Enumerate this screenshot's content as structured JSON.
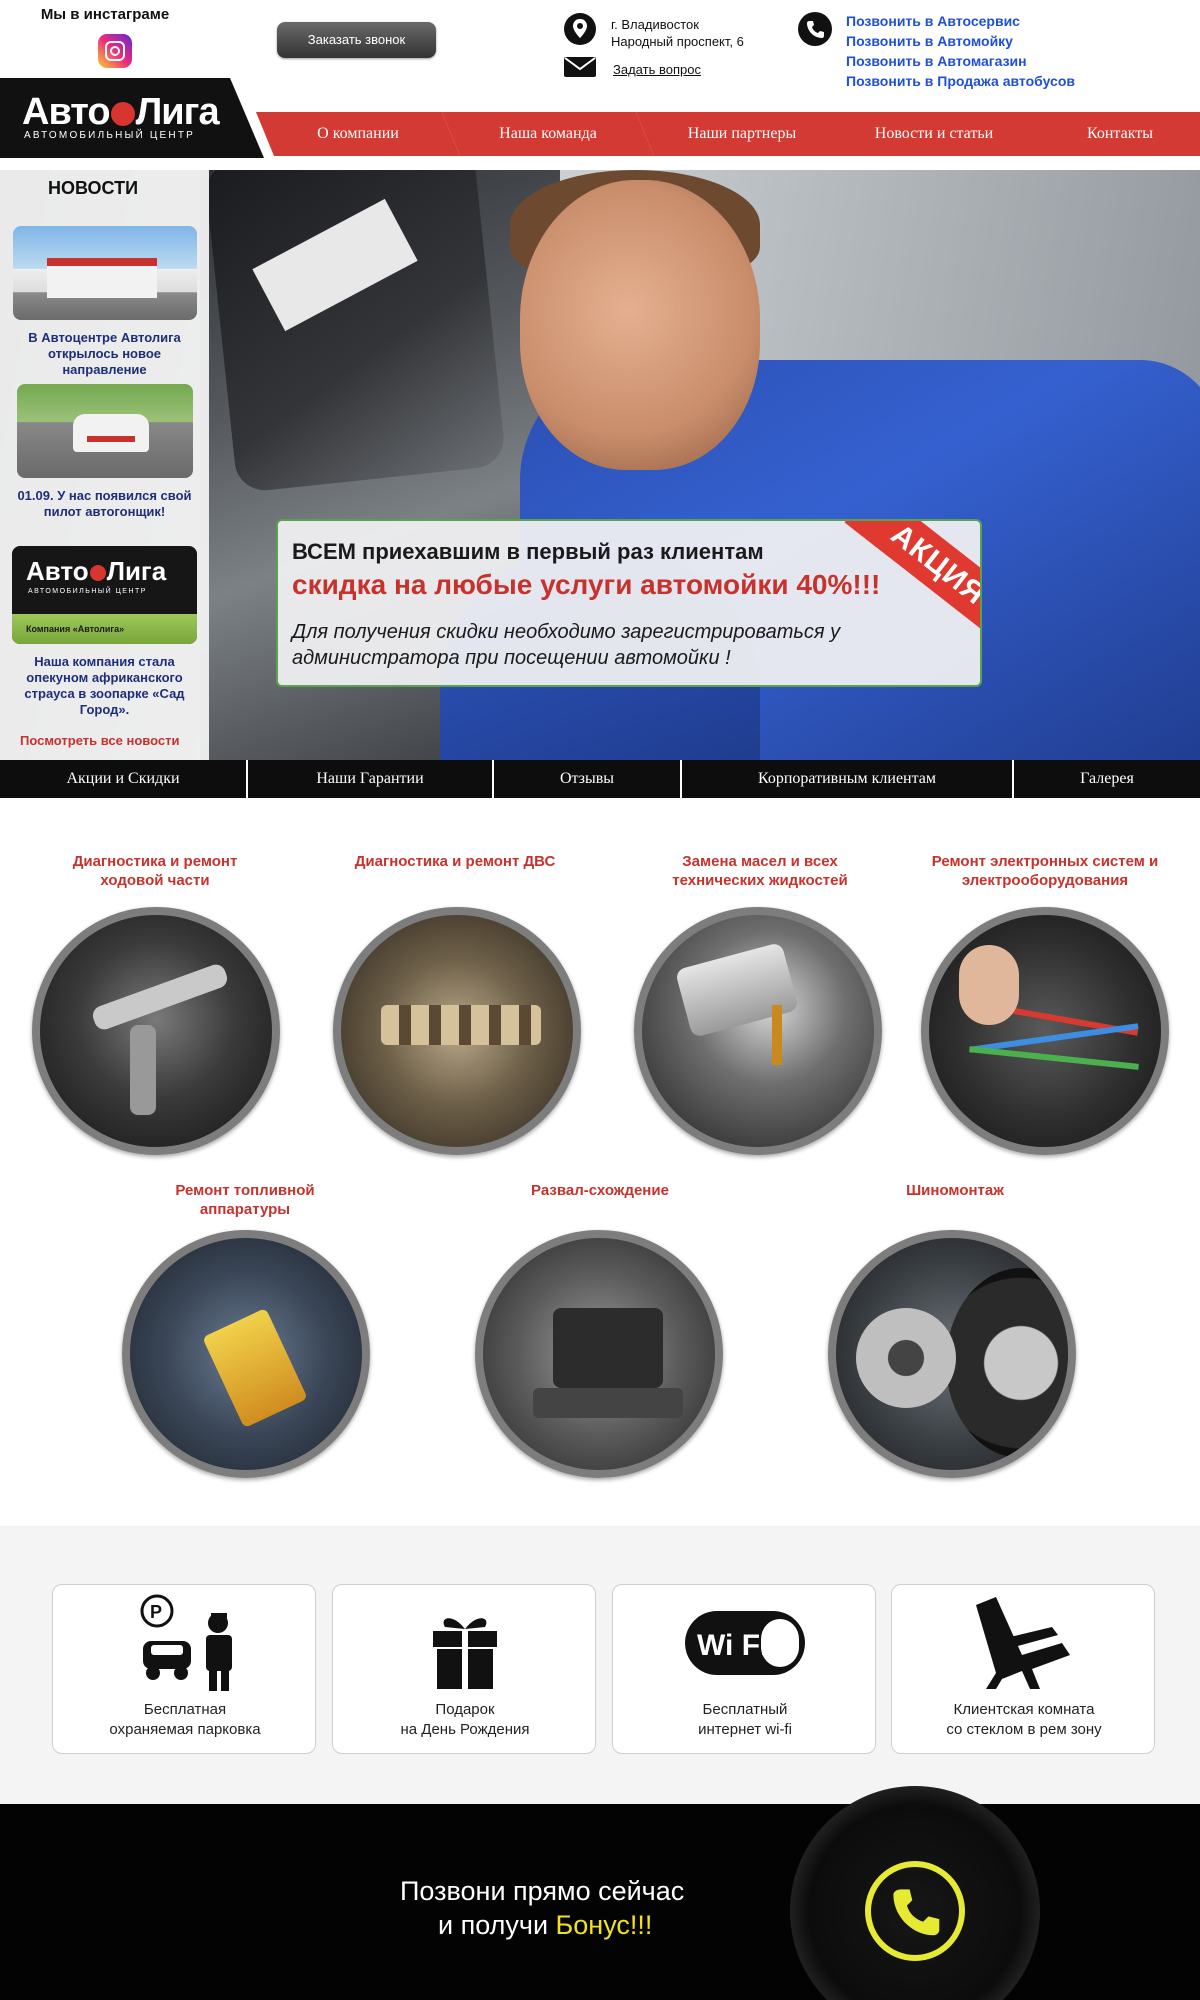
{
  "header": {
    "instagram_title": "Мы в инстаграме",
    "call_button": "Заказать звонок",
    "address_line1": "г. Владивосток",
    "address_line2": "Народный проспект, 6",
    "ask_question": "Задать вопрос",
    "call_links": [
      "Позвонить в Автосервис",
      "Позвонить в Автомойку",
      "Позвонить в Автомагазин",
      "Позвонить в Продажа автобусов"
    ],
    "link_color": "#1f4fd6"
  },
  "logo": {
    "name_part1": "Авто",
    "name_part2": "Лига",
    "subtitle": "АВТОМОБИЛЬНЫЙ ЦЕНТР"
  },
  "nav": {
    "items": [
      "О компании",
      "Наша команда",
      "Наши партнеры",
      "Новости и статьи",
      "Контакты"
    ],
    "accent": "#d23a33"
  },
  "news": {
    "title": "НОВОСТИ",
    "items": [
      "В Автоцентре Автолига открылось новое направление",
      "01.09. У нас появился свой пилот автогонщик!",
      "Наша компания стала опекуном африканского страуса в зоопарке «Сад Город»."
    ],
    "logo_card_caption": "Компания «Автолига»",
    "all_news": "Посмотреть все новости"
  },
  "promo": {
    "line1": "ВСЕМ приехавшим в первый раз клиентам",
    "line2": "скидка на любые  услуги автомойки 40%!!!",
    "line3": "Для получения скидки необходимо зарегистрироваться у администратора при посещении автомойки !",
    "ribbon": "АКЦИЯ"
  },
  "subnav": {
    "items": [
      "Акции и Скидки",
      "Наши Гарантии",
      "Отзывы",
      "Корпоративным клиентам",
      "Галерея"
    ]
  },
  "services": {
    "items": [
      "Диагностика и ремонт ходовой части",
      "Диагностика и ремонт ДВС",
      "Замена масел и всех технических жидкостей",
      "Ремонт электронных систем и электрооборудования",
      "Ремонт топливной аппаратуры",
      "Развал-схождение",
      "Шиномонтаж"
    ],
    "title_color": "#c8322c"
  },
  "features": {
    "items": [
      {
        "line1": "Бесплатная",
        "line2": "охраняемая парковка",
        "icon": "parking-guard-icon"
      },
      {
        "line1": "Подарок",
        "line2": "на День Рождения",
        "icon": "gift-icon"
      },
      {
        "line1": "Бесплатный",
        "line2": "интернет wi-fi",
        "icon": "wifi-icon"
      },
      {
        "line1": "Клиентская комната",
        "line2": "со стеклом в рем зону",
        "icon": "lounge-chair-icon"
      }
    ],
    "wifi_text": "Wi Fi"
  },
  "cta": {
    "line1": "Позвони прямо сейчас",
    "line2_prefix": "и получи ",
    "line2_bonus": "Бонус!!!",
    "bonus_color": "#f3e21a"
  }
}
